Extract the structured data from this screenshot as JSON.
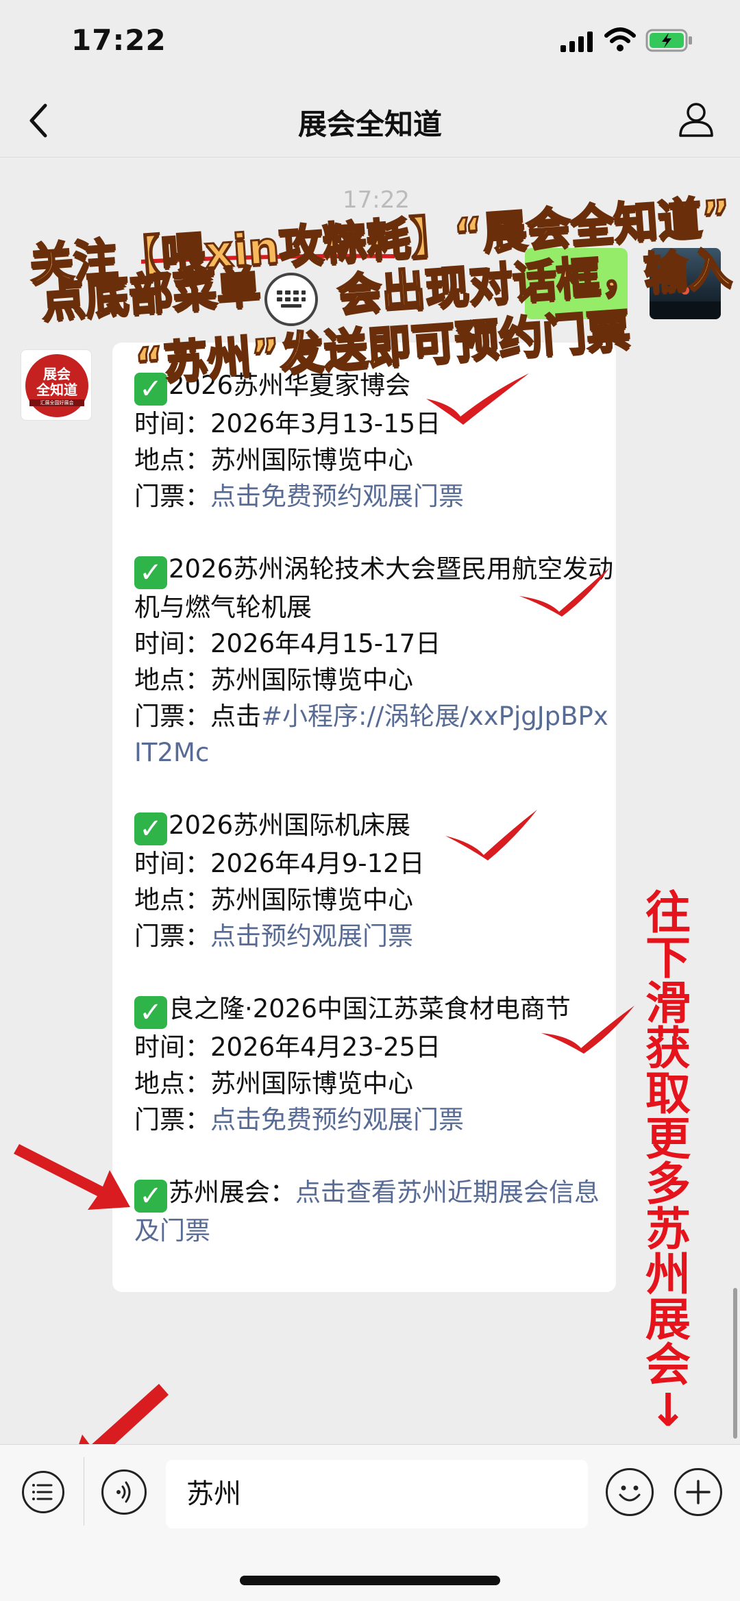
{
  "status_bar": {
    "time": "17:22"
  },
  "nav": {
    "title": "展会全知道"
  },
  "faint_timestamp": "17:22",
  "avatar_left": {
    "line1": "展会",
    "line2": "全知道",
    "small": "汇展全国好展会"
  },
  "banner": {
    "line1": "关注【喂xin攻粽耗】“展会全知道”",
    "line2a": "点底部菜单",
    "line2b": "会出现对话框，输入",
    "line3_open": "“",
    "line3_red": "苏州",
    "line3_rest": "”发送即可预约门票"
  },
  "message": {
    "items": [
      {
        "title": "2026苏州华夏家博会",
        "time": "时间：2026年3月13-15日",
        "place": "地点：苏州国际博览中心",
        "ticket_label": "门票：",
        "ticket_link": "点击免费预约观展门票"
      },
      {
        "title": "2026苏州涡轮技术大会暨民用航空发动机与燃气轮机展",
        "time": "时间：2026年4月15-17日",
        "place": "地点：苏州国际博览中心",
        "ticket_label": "门票：点击",
        "ticket_link": "#小程序://涡轮展/xxPjgJpBPxIT2Mc"
      },
      {
        "title": "2026苏州国际机床展",
        "time": "时间：2026年4月9-12日",
        "place": "地点：苏州国际博览中心",
        "ticket_label": "门票：",
        "ticket_link": "点击预约观展门票"
      },
      {
        "title": "良之隆·2026中国江苏菜食材电商节",
        "time": "时间：2026年4月23-25日",
        "place": "地点：苏州国际博览中心",
        "ticket_label": "门票：",
        "ticket_link": "点击免费预约观展门票"
      }
    ],
    "footer_label": "苏州展会：",
    "footer_link": "点击查看苏州近期展会信息及门票"
  },
  "side_text": "往下滑获取更多苏州展会↓",
  "input": {
    "value": "苏州"
  },
  "icons": {
    "back": "chevron-left-icon",
    "user": "user-icon",
    "menu": "list-menu-icon",
    "voice": "voice-icon",
    "emoji": "emoji-icon",
    "plus": "plus-icon"
  },
  "colors": {
    "link": "#576b95",
    "check": "#2fb44a",
    "banner_text": "#f6b95b",
    "annotation_red": "#e5141c"
  }
}
